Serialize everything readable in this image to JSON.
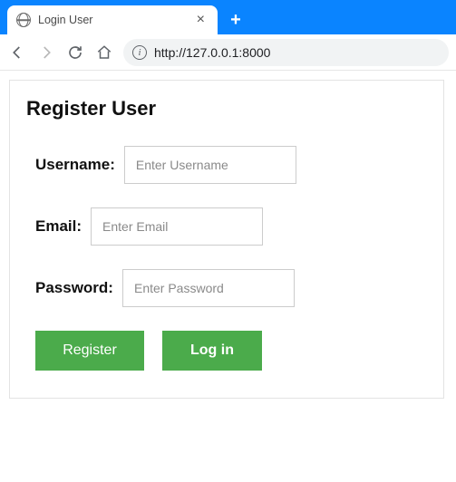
{
  "browser": {
    "tab_title": "Login User",
    "url": "http://127.0.0.1:8000"
  },
  "page": {
    "heading": "Register User",
    "fields": {
      "username": {
        "label": "Username:",
        "placeholder": "Enter Username",
        "value": ""
      },
      "email": {
        "label": "Email:",
        "placeholder": "Enter Email",
        "value": ""
      },
      "password": {
        "label": "Password:",
        "placeholder": "Enter Password",
        "value": ""
      }
    },
    "buttons": {
      "register": "Register",
      "login": "Log in"
    }
  }
}
